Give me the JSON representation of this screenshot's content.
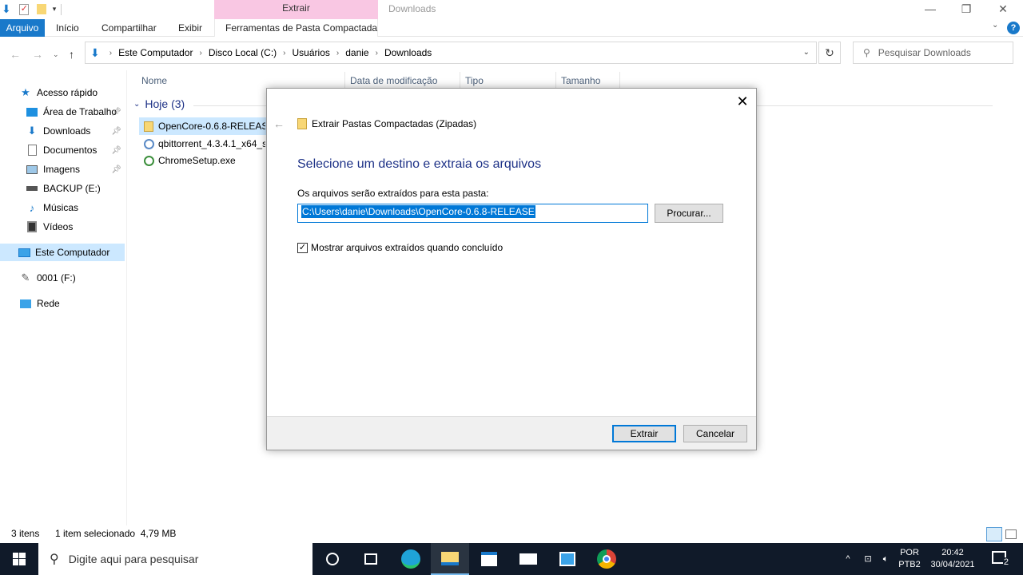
{
  "window": {
    "title": "Downloads",
    "context_header": "Extrair",
    "minimize": "—",
    "maximize": "❐",
    "close": "✕"
  },
  "ribbon": {
    "tabs": [
      "Arquivo",
      "Início",
      "Compartilhar",
      "Exibir",
      "Ferramentas de Pasta Compactada"
    ],
    "help": "?"
  },
  "address": {
    "crumbs": [
      "Este Computador",
      "Disco Local (C:)",
      "Usuários",
      "danie",
      "Downloads"
    ],
    "search_placeholder": "Pesquisar Downloads"
  },
  "nav": {
    "quick_access": "Acesso rápido",
    "items": [
      "Área de Trabalho",
      "Downloads",
      "Documentos",
      "Imagens",
      "BACKUP (E:)",
      "Músicas",
      "Vídeos"
    ],
    "this_pc": "Este Computador",
    "drive_f": "0001 (F:)",
    "network": "Rede"
  },
  "columns": {
    "name": "Nome",
    "modified": "Data de modificação",
    "type": "Tipo",
    "size": "Tamanho"
  },
  "group": {
    "label": "Hoje (3)"
  },
  "files": [
    {
      "name": "OpenCore-0.6.8-RELEASE.zip"
    },
    {
      "name": "qbittorrent_4.3.4.1_x64_setup.exe"
    },
    {
      "name": "ChromeSetup.exe"
    }
  ],
  "status": {
    "count": "3 itens",
    "selection": "1 item selecionado  4,79 MB"
  },
  "dialog": {
    "header": "Extrair Pastas Compactadas (Zipadas)",
    "heading": "Selecione um destino e extraia os arquivos",
    "label": "Os arquivos serão extraídos para esta pasta:",
    "path": "C:\\Users\\danie\\Downloads\\OpenCore-0.6.8-RELEASE",
    "browse": "Procurar...",
    "checkbox_label": "Mostrar arquivos extraídos quando concluído",
    "checkbox_checked": true,
    "extract": "Extrair",
    "cancel": "Cancelar"
  },
  "taskbar": {
    "search_placeholder": "Digite aqui para pesquisar",
    "lang_top": "POR",
    "lang_bottom": "PTB2",
    "time": "20:42",
    "date": "30/04/2021",
    "notifications": "2"
  }
}
